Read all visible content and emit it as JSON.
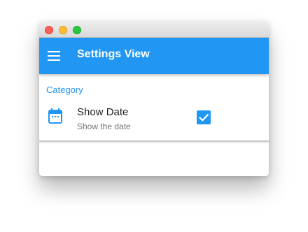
{
  "window": {
    "controls": [
      "close",
      "minimize",
      "maximize"
    ]
  },
  "appbar": {
    "title": "Settings View",
    "menu_icon": "hamburger-menu-icon",
    "color": "#2196f3"
  },
  "settings": {
    "category": "Category",
    "items": [
      {
        "icon": "calendar-icon",
        "title": "Show Date",
        "subtitle": "Show the date",
        "checked": true
      }
    ]
  },
  "colors": {
    "accent": "#2196f3",
    "title_text": "#212121",
    "subtitle_text": "#757575"
  }
}
